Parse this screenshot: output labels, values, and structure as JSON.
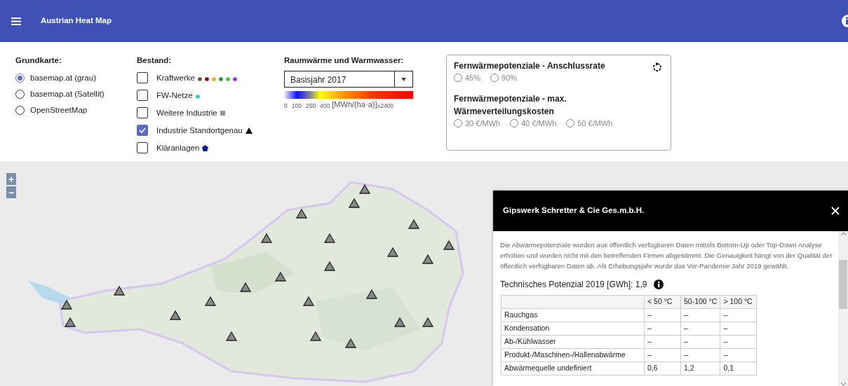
{
  "app_bar": {
    "title": "Austrian Heat Map"
  },
  "basemap": {
    "title": "Grundkarte:",
    "options": [
      {
        "label": "basemap.at (grau)",
        "selected": true
      },
      {
        "label": "basemap.at (Satellit)",
        "selected": false
      },
      {
        "label": "OpenStreetMap",
        "selected": false
      }
    ]
  },
  "inventory": {
    "title": "Bestand:",
    "layers": [
      {
        "label": "Kraftwerke",
        "checked": false,
        "markers": [
          {
            "kind": "dot",
            "color": "#6b4f2a"
          },
          {
            "kind": "dot",
            "color": "#8b0000"
          },
          {
            "kind": "dot",
            "color": "#ffa500"
          },
          {
            "kind": "dot",
            "color": "#2e8b2e"
          },
          {
            "kind": "dot",
            "color": "#33cc33"
          },
          {
            "kind": "dot",
            "color": "#9b30d0"
          }
        ]
      },
      {
        "label": "FW-Netze",
        "checked": false,
        "markers": [
          {
            "kind": "dot",
            "color": "#20d0d0"
          }
        ]
      },
      {
        "label": "Weitere Industrie",
        "checked": false,
        "markers": [
          {
            "kind": "square",
            "color": "#999999"
          }
        ]
      },
      {
        "label": "Industrie Standortgenau",
        "checked": true,
        "markers": [
          {
            "kind": "triangle",
            "color": "#000000"
          }
        ]
      },
      {
        "label": "Kläranlagen",
        "checked": false,
        "markers": [
          {
            "kind": "pentagon",
            "color": "#0a1a8a"
          }
        ]
      }
    ]
  },
  "heat_demand": {
    "title": "Raumwärme und Warmwasser:",
    "select": {
      "value": "Basisjahr 2017"
    },
    "scale": {
      "ticks": [
        "0",
        "100",
        "250",
        "400"
      ],
      "unit": "[MWh/(ha·a)]",
      "max_label": "≥2400"
    }
  },
  "potentials": {
    "groups": [
      {
        "title": "Fernwärmepotenziale - Anschlussrate",
        "options": [
          {
            "label": "45%",
            "selected": false
          },
          {
            "label": "90%",
            "selected": false
          }
        ]
      },
      {
        "title": "Fernwärmepotenziale - max. Wärmeverteilungskosten",
        "options": [
          {
            "label": "30 €/MWh",
            "selected": false
          },
          {
            "label": "40 €/MWh",
            "selected": false
          },
          {
            "label": "50 €/MWh",
            "selected": false
          }
        ]
      }
    ]
  },
  "map": {
    "zoom_in": "+",
    "zoom_out": "−"
  },
  "popup": {
    "title": "Gipswerk Schretter & Cie Ges.m.b.H.",
    "description": "Die Abwärmepotenziale wurden aus öffentlich verfügbaren Daten mittels Bottom-Up oder Top-Down Analyse erhoben und wurden nicht mit den betreffenden Firmen abgestimmt. Die Genauigkeit hängt von der Qualität der öffentlich verfügbaren Daten ab. Als Erhebungsjahr wurde das Vor-Pandemie Jahr 2019 gewählt.",
    "potential": "Technisches Potenzial 2019 [GWh]: 1,9",
    "table": {
      "columns": [
        "< 50 °C",
        "50-100 °C",
        "> 100 °C"
      ],
      "rows": [
        {
          "label": "Rauchgas",
          "values": [
            "–",
            "–",
            "–"
          ]
        },
        {
          "label": "Kondensation",
          "values": [
            "–",
            "–",
            "–"
          ]
        },
        {
          "label": "Ab-/Kühlwasser",
          "values": [
            "–",
            "–",
            "–"
          ]
        },
        {
          "label": "Produkt-/Maschinen-/Hallenabwärme",
          "values": [
            "–",
            "–",
            "–"
          ]
        },
        {
          "label": "Abwärmequelle undefiniert",
          "values": [
            "0,6",
            "1,2",
            "0,1"
          ]
        }
      ]
    }
  }
}
